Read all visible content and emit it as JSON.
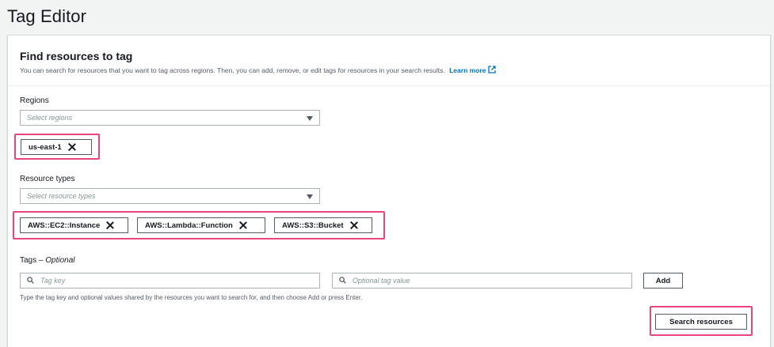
{
  "page": {
    "title": "Tag Editor"
  },
  "panel": {
    "title": "Find resources to tag",
    "description": "You can search for resources that you want to tag across regions. Then, you can add, remove, or edit tags for resources in your search results.",
    "learn_more": "Learn more"
  },
  "regions": {
    "label": "Regions",
    "placeholder": "Select regions",
    "selected": [
      "us-east-1"
    ]
  },
  "resource_types": {
    "label": "Resource types",
    "placeholder": "Select resource types",
    "selected": [
      "AWS::EC2::Instance",
      "AWS::Lambda::Function",
      "AWS::S3::Bucket"
    ]
  },
  "tags": {
    "label": "Tags – ",
    "label_optional": "Optional",
    "key_placeholder": "Tag key",
    "value_placeholder": "Optional tag value",
    "add_label": "Add",
    "hint": "Type the tag key and optional values shared by the resources you want to search for, and then choose Add or press Enter."
  },
  "actions": {
    "search_label": "Search resources"
  },
  "colors": {
    "highlight": "#e8467c",
    "link": "#0073bb"
  }
}
